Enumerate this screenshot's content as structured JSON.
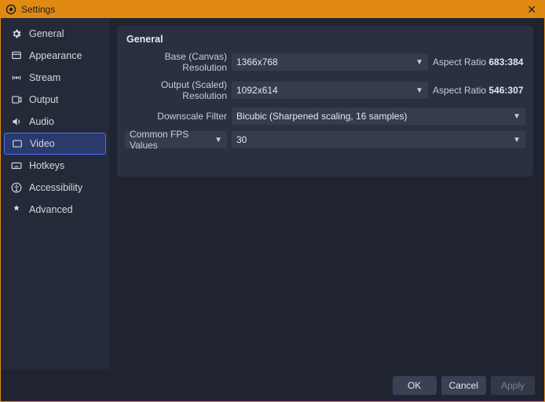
{
  "window": {
    "title": "Settings"
  },
  "sidebar": {
    "items": [
      {
        "label": "General"
      },
      {
        "label": "Appearance"
      },
      {
        "label": "Stream"
      },
      {
        "label": "Output"
      },
      {
        "label": "Audio"
      },
      {
        "label": "Video"
      },
      {
        "label": "Hotkeys"
      },
      {
        "label": "Accessibility"
      },
      {
        "label": "Advanced"
      }
    ],
    "selected_index": 5
  },
  "panel": {
    "title": "General",
    "base_label": "Base (Canvas) Resolution",
    "base_value": "1366x768",
    "base_aspect_prefix": "Aspect Ratio ",
    "base_aspect_value": "683:384",
    "output_label": "Output (Scaled) Resolution",
    "output_value": "1092x614",
    "output_aspect_prefix": "Aspect Ratio ",
    "output_aspect_value": "546:307",
    "downscale_label": "Downscale Filter",
    "downscale_value": "Bicubic (Sharpened scaling, 16 samples)",
    "fps_label": "Common FPS Values",
    "fps_value": "30"
  },
  "footer": {
    "ok": "OK",
    "cancel": "Cancel",
    "apply": "Apply"
  }
}
